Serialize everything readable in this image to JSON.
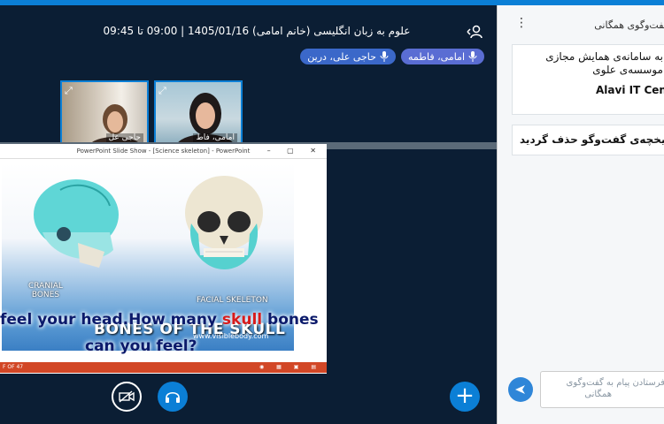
{
  "header": {
    "title": "علوم به زبان انگلیسی (خانم امامی) 1405/01/16 | 09:00 تا 09:45"
  },
  "talkers": [
    {
      "label": "امامی، فاطمه",
      "active": true
    },
    {
      "label": "حاجی علی، درین",
      "active": false
    }
  ],
  "videos": [
    {
      "name": "امامی، فاط"
    },
    {
      "name": "حاجی عل"
    }
  ],
  "presentation": {
    "window_title": "PowerPoint Slide Show - [Science skeleton] - PowerPoint",
    "window_buttons": "– ▢ ✕",
    "cranial_label_1": "CRANIAL",
    "cranial_label_2": "BONES",
    "facial_label": "FACIAL SKELETON",
    "slide_title": "BONES OF THE SKULL",
    "caption_a": "feel your head.How many ",
    "caption_red": "skull",
    "caption_b": " bones",
    "caption_line2": "can you feel?",
    "website": "www.visiblebody.com",
    "status_left": "F OF 47",
    "status_right": "◉ ▦ ▣ ▤"
  },
  "chat": {
    "header_title": "گفت‌وگوی همگانی",
    "menu_icon": "⋮",
    "message1_line1": "به سامانه‌ی همایش مجازی",
    "message1_line2": "موسسه‌ی علوی",
    "message1_bold": "Alavi IT Center",
    "message2": "تاریخچه‌ی گفت‌وگو حذف گردید",
    "input_placeholder_line1": "فرستادن پیام به گفت‌وگوی",
    "input_placeholder_line2": "همگانی"
  },
  "colors": {
    "accent": "#0b7fd6",
    "background": "#0b1e34",
    "talker": "#3b68c9",
    "ppt_status": "#d24726"
  }
}
